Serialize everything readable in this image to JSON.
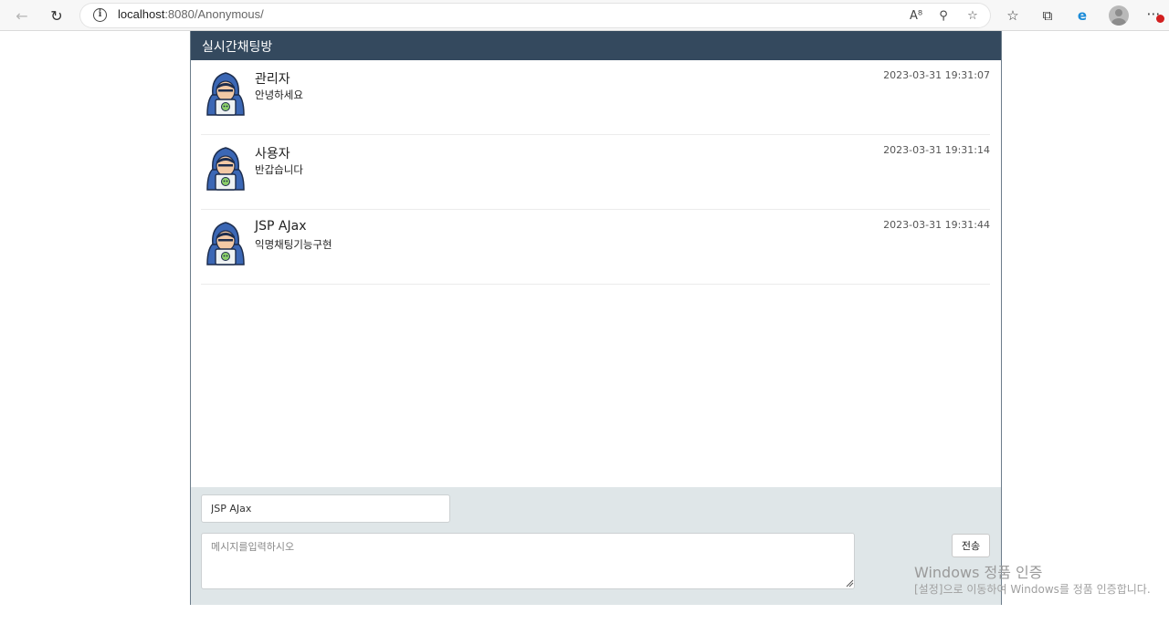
{
  "browser": {
    "url_host": "localhost",
    "url_path": ":8080/Anonymous/",
    "icons": [
      "back-icon",
      "reload-icon",
      "info-icon",
      "read-aloud-icon",
      "zoom-icon",
      "add-favorite-icon",
      "favorites-icon",
      "collections-icon",
      "edge-icon",
      "profile-icon",
      "more-icon"
    ]
  },
  "chat": {
    "title": "실시간채팅방",
    "messages": [
      {
        "name": "관리자",
        "text": "안녕하세요",
        "time": "2023-03-31 19:31:07"
      },
      {
        "name": "사용자",
        "text": "반갑습니다",
        "time": "2023-03-31 19:31:14"
      },
      {
        "name": "JSP AJax",
        "text": "익명채팅기능구현",
        "time": "2023-03-31 19:31:44"
      }
    ]
  },
  "compose": {
    "name_value": "JSP AJax",
    "message_placeholder": "메시지를입력하시오",
    "send_label": "전송"
  },
  "watermark": {
    "title": "Windows 정품 인증",
    "subtitle": "[설정]으로 이동하여 Windows를 정품 인증합니다."
  },
  "colors": {
    "header_bg": "#34495e",
    "compose_bg": "#dfe6e8",
    "avatar_hood": "#3b67b5"
  }
}
